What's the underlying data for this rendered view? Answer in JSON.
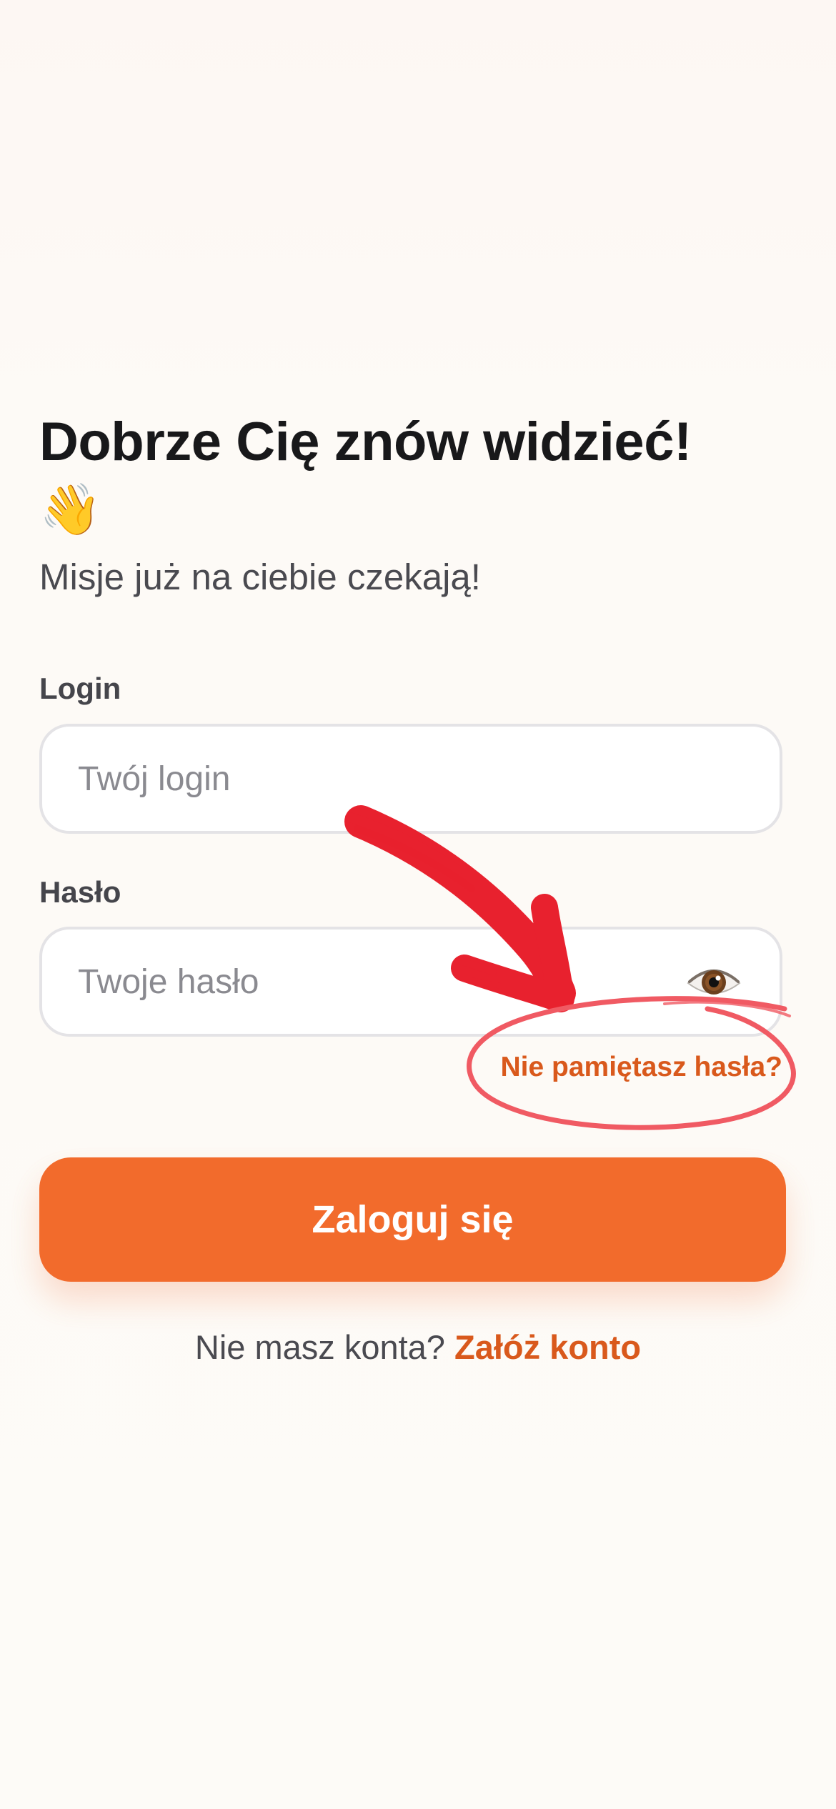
{
  "header": {
    "title": "Dobrze Cię znów widzieć!",
    "title_emoji": "👋",
    "subtitle": "Misje już na ciebie czekają!"
  },
  "form": {
    "login_label": "Login",
    "login_placeholder": "Twój login",
    "login_value": "",
    "password_label": "Hasło",
    "password_placeholder": "Twoje hasło",
    "password_value": "",
    "password_toggle_icon": "eye-icon",
    "forgot_password": "Nie pamiętasz hasła?",
    "submit_label": "Zaloguj się"
  },
  "footer": {
    "no_account_text": "Nie masz konta?",
    "signup_link": "Załóż konto"
  },
  "colors": {
    "accent": "#f26b2c",
    "accent_text": "#d9591c",
    "annotation": "#e8212e"
  }
}
